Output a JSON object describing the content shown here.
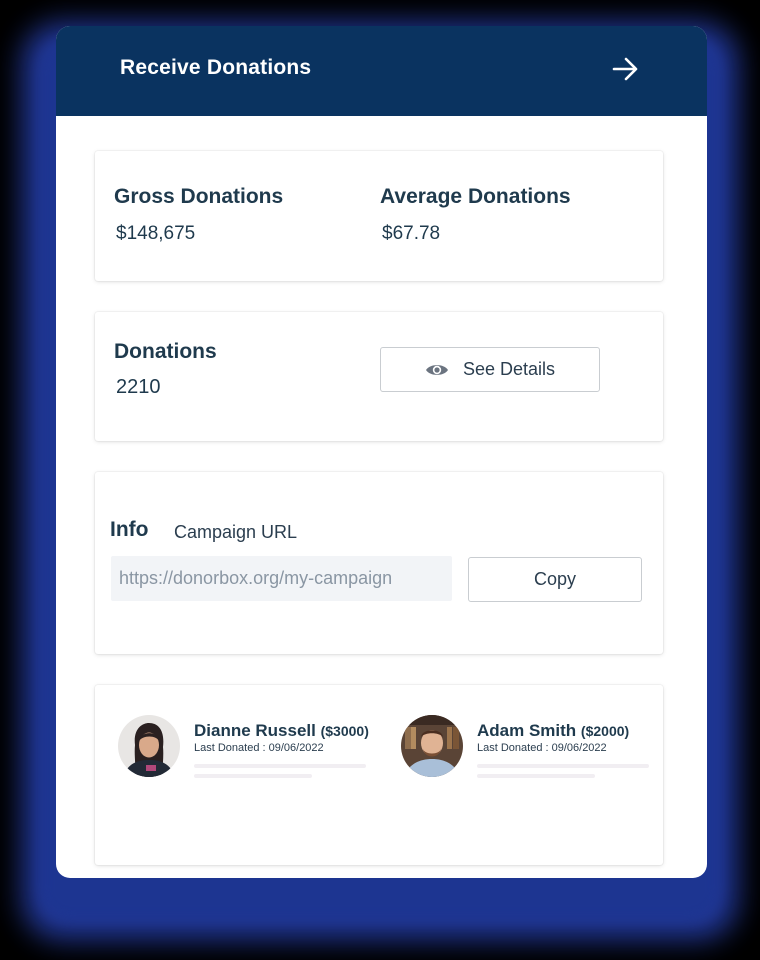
{
  "header": {
    "title": "Receive Donations",
    "arrow_icon": "arrow-right-icon"
  },
  "stats": {
    "gross_label": "Gross Donations",
    "gross_value": "$148,675",
    "average_label": "Average Donations",
    "average_value": "$67.78"
  },
  "donations": {
    "label": "Donations",
    "count": "2210",
    "see_details_label": "See Details",
    "see_details_icon": "eye-icon"
  },
  "info": {
    "title": "Info",
    "subtitle": "Campaign URL",
    "url_placeholder": "https://donorbox.org/my-campaign",
    "copy_label": "Copy"
  },
  "donors": [
    {
      "name": "Dianne Russell",
      "amount": "($3000)",
      "last_donated": "Last Donated : 09/06/2022"
    },
    {
      "name": "Adam Smith",
      "amount": "($2000)",
      "last_donated": "Last Donated : 09/06/2022"
    }
  ],
  "colors": {
    "header_bg": "#0a3360",
    "text_primary": "#1f3a4d",
    "glow": "#233a9e"
  }
}
